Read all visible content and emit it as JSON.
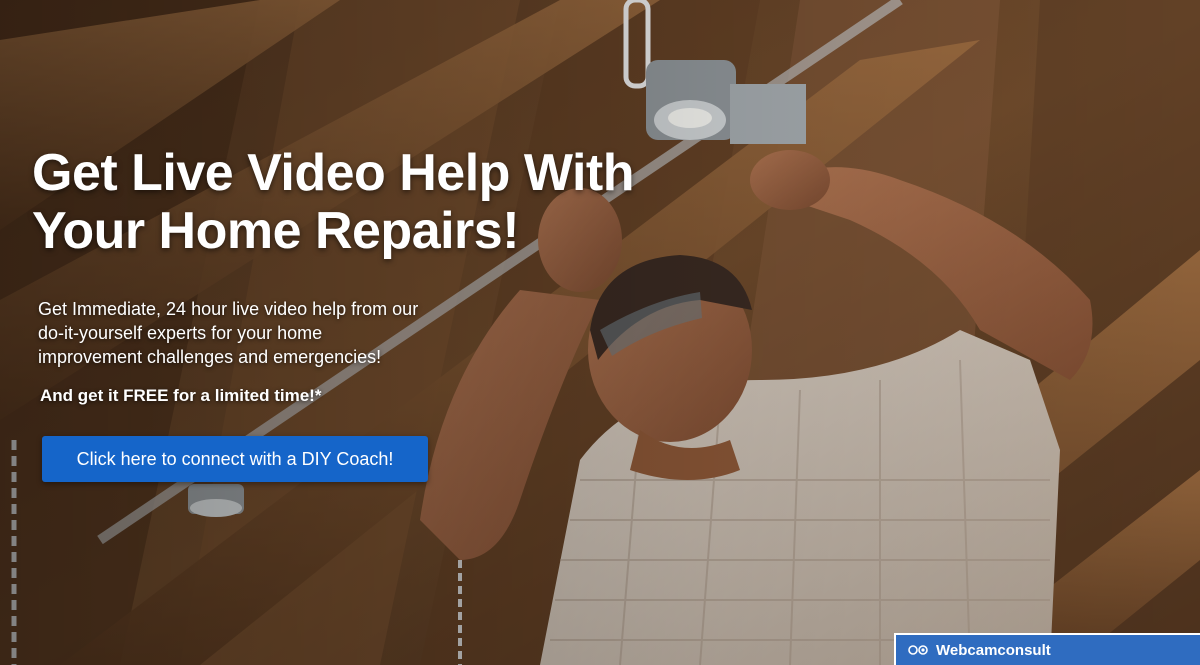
{
  "hero": {
    "title_lines": [
      "Get Live Video Help With",
      "Your Home Repairs!"
    ],
    "description_lines": [
      "Get Immediate, 24 hour live video help from our",
      "do-it-yourself experts for your home",
      "improvement challenges and emergencies!"
    ],
    "promo": "And get it FREE for a limited time!*",
    "cta_label": "Click here to connect with a DIY Coach!",
    "background_image": "photo-man-repairing-ceiling-light"
  },
  "badge": {
    "label": "Webcamconsult",
    "icon": "webcamconsult-logo-icon"
  },
  "colors": {
    "cta_bg": "#1565c9",
    "badge_bg": "#2f6cc0",
    "text": "#ffffff"
  }
}
